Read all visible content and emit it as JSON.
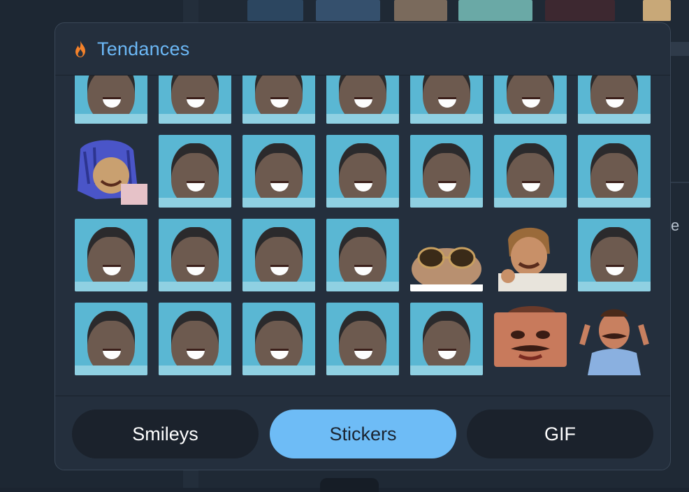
{
  "panel": {
    "title": "Tendances",
    "title_icon": "fire-icon",
    "accent_color": "#6cb8f6"
  },
  "stickers": [
    {
      "name": "sticker-laugh-face"
    },
    {
      "name": "sticker-laugh-face"
    },
    {
      "name": "sticker-laugh-face"
    },
    {
      "name": "sticker-laugh-face"
    },
    {
      "name": "sticker-laugh-face"
    },
    {
      "name": "sticker-laugh-face"
    },
    {
      "name": "sticker-laugh-face"
    },
    {
      "name": "sticker-blue-hair-character"
    },
    {
      "name": "sticker-laugh-face"
    },
    {
      "name": "sticker-laugh-face"
    },
    {
      "name": "sticker-laugh-face"
    },
    {
      "name": "sticker-laugh-face"
    },
    {
      "name": "sticker-laugh-face"
    },
    {
      "name": "sticker-laugh-face"
    },
    {
      "name": "sticker-laugh-face"
    },
    {
      "name": "sticker-laugh-face"
    },
    {
      "name": "sticker-laugh-face"
    },
    {
      "name": "sticker-laugh-face"
    },
    {
      "name": "sticker-cat-sunglasses"
    },
    {
      "name": "sticker-laughing-man"
    },
    {
      "name": "sticker-laugh-face"
    },
    {
      "name": "sticker-laugh-face"
    },
    {
      "name": "sticker-laugh-face"
    },
    {
      "name": "sticker-laugh-face"
    },
    {
      "name": "sticker-laugh-face"
    },
    {
      "name": "sticker-laugh-face"
    },
    {
      "name": "sticker-mustache-man-crying"
    },
    {
      "name": "sticker-mustache-man-shrug"
    }
  ],
  "tabs": [
    {
      "label": "Smileys",
      "active": false
    },
    {
      "label": "Stickers",
      "active": true
    },
    {
      "label": "GIF",
      "active": false
    }
  ],
  "background": {
    "partial_text": "e"
  }
}
